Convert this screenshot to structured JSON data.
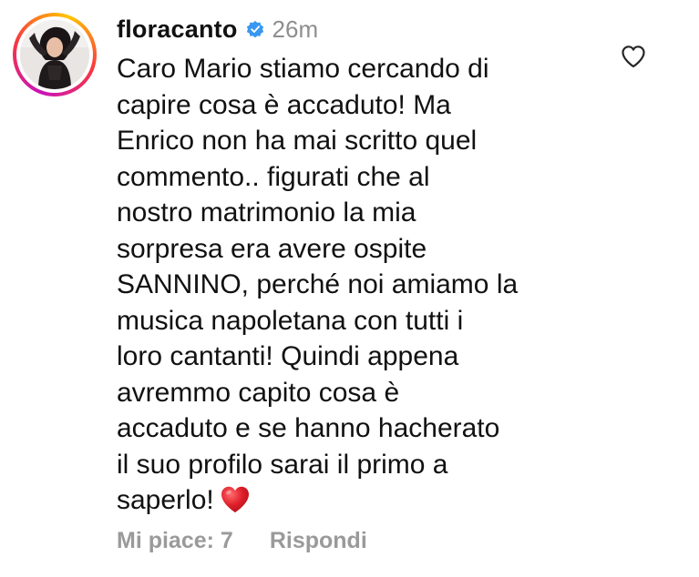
{
  "comment": {
    "username": "floracanto",
    "verified": true,
    "timestamp": "26m",
    "body_lines": [
      "Caro Mario stiamo cercando di",
      "capire cosa è accaduto! Ma",
      "Enrico non ha mai scritto quel",
      "commento.. figurati che al",
      "nostro matrimonio la mia",
      "sorpresa era avere ospite",
      "SANNINO, perché noi amiamo la",
      "musica napoletana con tutti i",
      "loro cantanti! Quindi appena",
      "avremmo capito cosa è",
      "accaduto e se hanno hacherato",
      "il suo profilo sarai il primo a",
      "saperlo!"
    ],
    "emoji": "red-heart-emoji",
    "likes_label": "Mi piace: 7",
    "reply_label": "Rispondi"
  },
  "icons": {
    "verified": "verified-badge-icon",
    "like": "heart-outline-icon"
  },
  "colors": {
    "verified_blue": "#3897f0",
    "meta_gray": "#8e8e8e",
    "heart_red": "#e0202b"
  }
}
